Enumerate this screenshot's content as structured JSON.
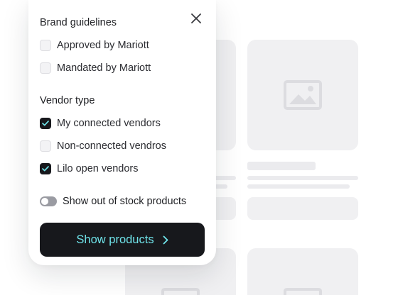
{
  "filters": {
    "brand_guidelines": {
      "title": "Brand guidelines",
      "options": [
        {
          "label": "Approved by Mariott",
          "checked": false
        },
        {
          "label": "Mandated by Mariott",
          "checked": false
        }
      ]
    },
    "vendor_type": {
      "title": "Vendor type",
      "options": [
        {
          "label": "My connected vendors",
          "checked": true
        },
        {
          "label": "Non-connected vendros",
          "checked": false
        },
        {
          "label": "Lilo open vendors",
          "checked": true
        }
      ]
    },
    "stock_toggle": {
      "label": "Show out of stock products",
      "on": false
    },
    "submit": {
      "label": "Show products"
    }
  },
  "icons": {
    "close": "close-icon",
    "checkmark": "check-icon",
    "chevron": "chevron-right-icon",
    "placeholder": "image-placeholder-icon"
  },
  "colors": {
    "button_bg": "#17181c",
    "button_text": "#6fe3e9",
    "checkbox_checked": "#17181c",
    "toggle_off": "#9a9ba2",
    "placeholder_bg": "#f0f0f2"
  }
}
